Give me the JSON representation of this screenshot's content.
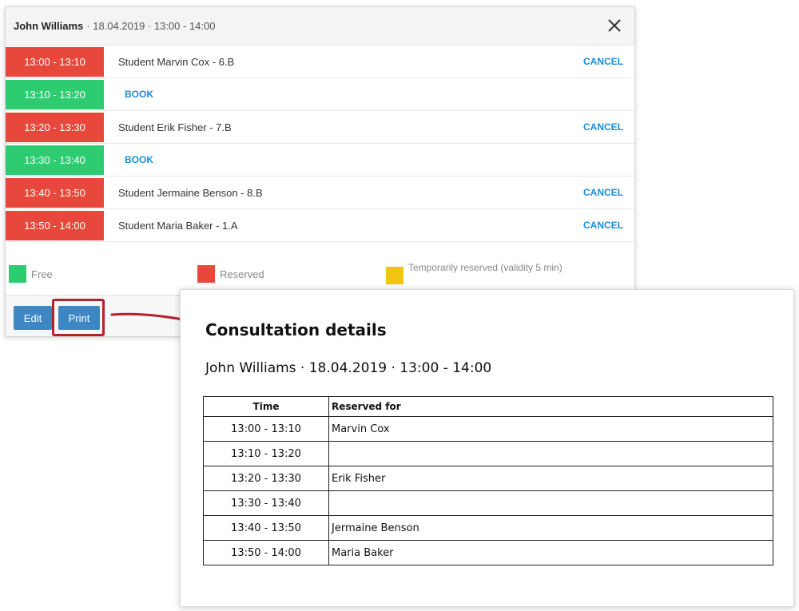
{
  "modal": {
    "teacher": "John Williams",
    "meta": "· 18.04.2019 · 13:00 - 14:00",
    "close_icon": "close-icon",
    "slots": [
      {
        "time": "13:00 - 13:10",
        "status": "reserved",
        "student": "Student Marvin Cox - 6.B",
        "action": "CANCEL"
      },
      {
        "time": "13:10 - 13:20",
        "status": "free",
        "student": "",
        "action": "BOOK"
      },
      {
        "time": "13:20 - 13:30",
        "status": "reserved",
        "student": "Student Erik Fisher - 7.B",
        "action": "CANCEL"
      },
      {
        "time": "13:30 - 13:40",
        "status": "free",
        "student": "",
        "action": "BOOK"
      },
      {
        "time": "13:40 - 13:50",
        "status": "reserved",
        "student": "Student Jermaine Benson - 8.B",
        "action": "CANCEL"
      },
      {
        "time": "13:50 - 14:00",
        "status": "reserved",
        "student": "Student Maria Baker - 1.A",
        "action": "CANCEL"
      }
    ],
    "legend": {
      "free": "Free",
      "reserved": "Reserved",
      "temporary": "Temporarily reserved (validity 5 min)"
    },
    "buttons": {
      "edit": "Edit",
      "print": "Print"
    }
  },
  "colors": {
    "free": "#2ecc71",
    "reserved": "#e8483b",
    "temporary": "#f1c40f",
    "link": "#1a8dd8",
    "button": "#3d87c5",
    "highlight": "#b3222a"
  },
  "preview": {
    "title": "Consultation details",
    "subtitle": "John Williams · 18.04.2019 · 13:00 - 14:00",
    "columns": [
      "Time",
      "Reserved for"
    ],
    "rows": [
      [
        "13:00 - 13:10",
        "Marvin Cox"
      ],
      [
        "13:10 - 13:20",
        ""
      ],
      [
        "13:20 - 13:30",
        "Erik Fisher"
      ],
      [
        "13:30 - 13:40",
        ""
      ],
      [
        "13:40 - 13:50",
        "Jermaine Benson"
      ],
      [
        "13:50 - 14:00",
        "Maria Baker"
      ]
    ]
  }
}
